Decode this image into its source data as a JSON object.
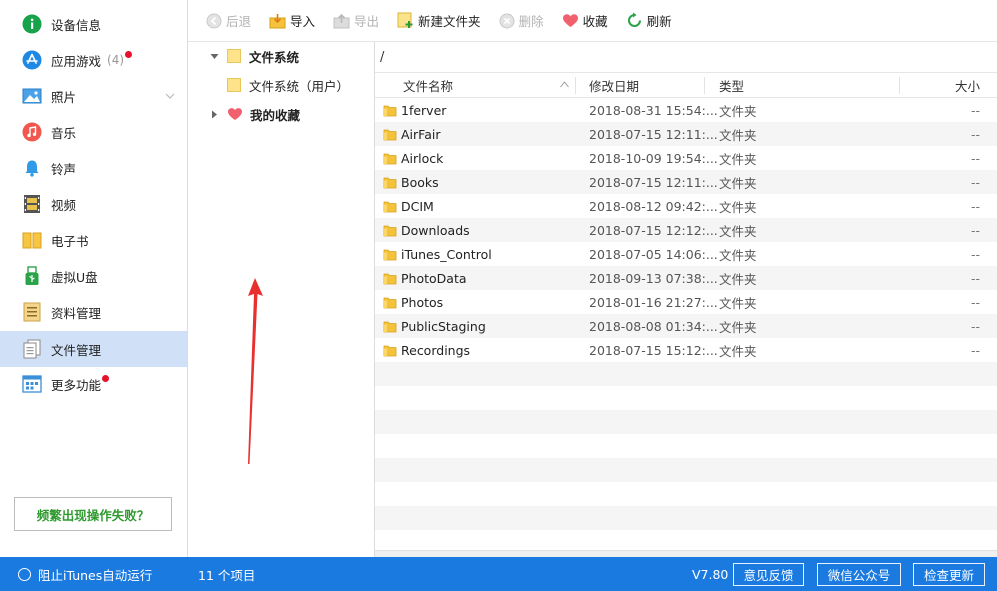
{
  "sidebar": {
    "items": [
      {
        "label": "设备信息",
        "icon": "info-icon"
      },
      {
        "label": "应用游戏",
        "icon": "app-store-icon",
        "count": "(4)",
        "dot": true
      },
      {
        "label": "照片",
        "icon": "photo-icon",
        "chevron": true
      },
      {
        "label": "音乐",
        "icon": "music-icon"
      },
      {
        "label": "铃声",
        "icon": "bell-icon"
      },
      {
        "label": "视频",
        "icon": "film-icon"
      },
      {
        "label": "电子书",
        "icon": "book-icon"
      },
      {
        "label": "虚拟U盘",
        "icon": "usb-icon"
      },
      {
        "label": "资料管理",
        "icon": "contacts-icon"
      },
      {
        "label": "文件管理",
        "icon": "files-icon",
        "active": true
      },
      {
        "label": "更多功能",
        "icon": "grid-icon",
        "dot": true
      }
    ],
    "help_label": "频繁出现操作失败？"
  },
  "toolbar": {
    "back": "后退",
    "import": "导入",
    "export": "导出",
    "new_folder": "新建文件夹",
    "delete": "删除",
    "favorite": "收藏",
    "refresh": "刷新"
  },
  "tree": {
    "root": "文件系统",
    "child": "文件系统（用户）",
    "favorites": "我的收藏"
  },
  "path": "/",
  "table": {
    "headers": {
      "name": "文件名称",
      "date": "修改日期",
      "type": "类型",
      "size": "大小"
    },
    "rows": [
      {
        "name": "1ferver",
        "date": "2018-08-31 15:54:...",
        "type": "文件夹",
        "size": "--"
      },
      {
        "name": "AirFair",
        "date": "2018-07-15 12:11:...",
        "type": "文件夹",
        "size": "--"
      },
      {
        "name": "Airlock",
        "date": "2018-10-09 19:54:...",
        "type": "文件夹",
        "size": "--"
      },
      {
        "name": "Books",
        "date": "2018-07-15 12:11:...",
        "type": "文件夹",
        "size": "--"
      },
      {
        "name": "DCIM",
        "date": "2018-08-12 09:42:...",
        "type": "文件夹",
        "size": "--"
      },
      {
        "name": "Downloads",
        "date": "2018-07-15 12:12:...",
        "type": "文件夹",
        "size": "--"
      },
      {
        "name": "iTunes_Control",
        "date": "2018-07-05 14:06:...",
        "type": "文件夹",
        "size": "--"
      },
      {
        "name": "PhotoData",
        "date": "2018-09-13 07:38:...",
        "type": "文件夹",
        "size": "--"
      },
      {
        "name": "Photos",
        "date": "2018-01-16 21:27:...",
        "type": "文件夹",
        "size": "--"
      },
      {
        "name": "PublicStaging",
        "date": "2018-08-08 01:34:...",
        "type": "文件夹",
        "size": "--"
      },
      {
        "name": "Recordings",
        "date": "2018-07-15 15:12:...",
        "type": "文件夹",
        "size": "--"
      }
    ]
  },
  "status": {
    "itunes_toggle": "阻止iTunes自动运行",
    "count": "11 个项目",
    "version": "V7.80",
    "feedback": "意见反馈",
    "wechat": "微信公众号",
    "update": "检查更新"
  },
  "colors": {
    "accent": "#1a7ae0",
    "active_nav": "#cfe0f7",
    "folder": "#f5c33b",
    "help_text": "#2f9a2f",
    "arrow": "#e8302f"
  }
}
